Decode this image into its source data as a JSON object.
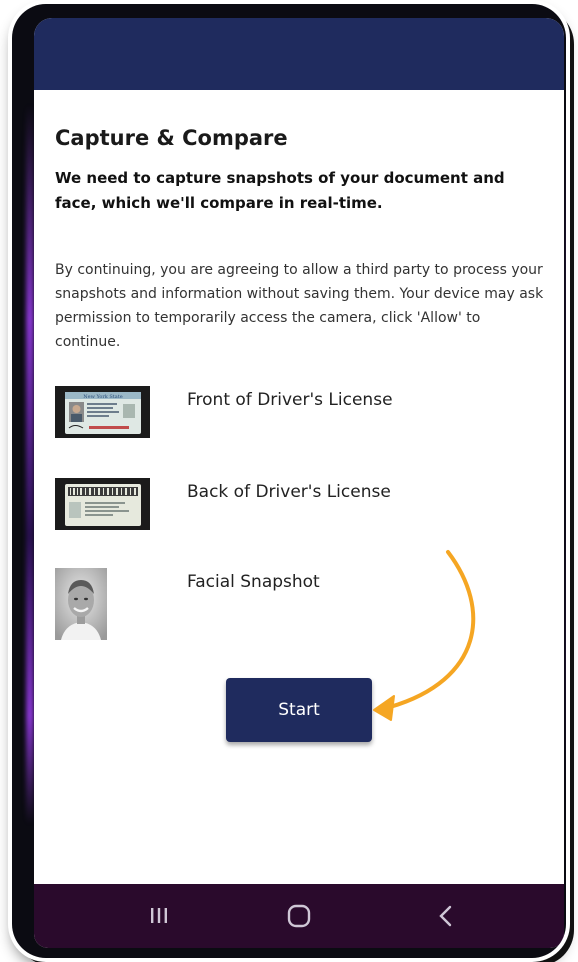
{
  "screen": {
    "title": "Capture & Compare",
    "subtitle": "We need to capture snapshots of your document and face, which we'll compare in real-time.",
    "consent_text": "By continuing, you are agreeing to allow a third party to process your snapshots and information without saving them. Your device may ask permission to temporarily access the camera, click 'Allow' to continue.",
    "items": [
      {
        "label": "Front of Driver's License",
        "icon": "id-card-front-icon"
      },
      {
        "label": "Back of Driver's License",
        "icon": "id-card-back-icon"
      },
      {
        "label": "Facial Snapshot",
        "icon": "face-photo-icon"
      }
    ],
    "start_button": "Start"
  },
  "license_card": {
    "state_text": "New York State"
  },
  "nav": {
    "recents_icon": "recents-icon",
    "home_icon": "home-icon",
    "back_icon": "back-icon"
  },
  "colors": {
    "header": "#1f2b5e",
    "button": "#1f2b5e",
    "arrow": "#f5a623",
    "navbar": "#2a0a2c"
  }
}
